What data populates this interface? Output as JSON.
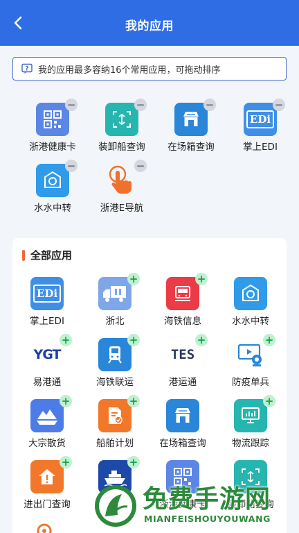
{
  "header": {
    "title": "我的应用"
  },
  "notice": {
    "text": "我的应用最多容纳16个常用应用，可拖动排序"
  },
  "my_apps": [
    {
      "label": "浙港健康卡",
      "icon": "qr-code-icon"
    },
    {
      "label": "装卸船查询",
      "icon": "crane-scan-icon"
    },
    {
      "label": "在场箱查询",
      "icon": "store-icon"
    },
    {
      "label": "掌上EDI",
      "icon": "edi-icon"
    },
    {
      "label": "水水中转",
      "icon": "transfer-icon"
    },
    {
      "label": "浙港E导航",
      "icon": "hand-pointer-icon"
    }
  ],
  "all_apps": {
    "title": "全部应用",
    "items": [
      {
        "label": "掌上EDI",
        "icon": "edi-icon"
      },
      {
        "label": "浙北",
        "icon": "truck-icon"
      },
      {
        "label": "海铁信息",
        "icon": "train-icon"
      },
      {
        "label": "水水中转",
        "icon": "transfer-icon"
      },
      {
        "label": "易港通",
        "icon": "ygt-logo-icon"
      },
      {
        "label": "海铁联运",
        "icon": "train-front-icon"
      },
      {
        "label": "港运通",
        "icon": "tes-logo-icon"
      },
      {
        "label": "防疫单兵",
        "icon": "webcam-icon"
      },
      {
        "label": "大宗散货",
        "icon": "bulk-cargo-icon"
      },
      {
        "label": "船舶计划",
        "icon": "document-check-icon"
      },
      {
        "label": "在场箱查询",
        "icon": "store-icon"
      },
      {
        "label": "物流跟踪",
        "icon": "monitor-chart-icon"
      },
      {
        "label": "进出门查询",
        "icon": "home-alert-icon"
      },
      {
        "label": "",
        "icon": "ship-icon"
      },
      {
        "label": "浙港健康卡",
        "icon": "qr-code-icon"
      },
      {
        "label": "装卸船查询",
        "icon": "crane-scan-icon"
      }
    ]
  },
  "icon_text": {
    "edi": "EDi",
    "ygt": "YGT",
    "tes": "TES"
  },
  "watermark": {
    "cn": "免费手游网",
    "en": "MIANFEISHOUYOUWANG"
  },
  "colors": {
    "header": "#2f6de5",
    "accent": "#ef6a3a",
    "plus_badge": "#bff0cf",
    "minus_badge": "#d4d7df"
  }
}
